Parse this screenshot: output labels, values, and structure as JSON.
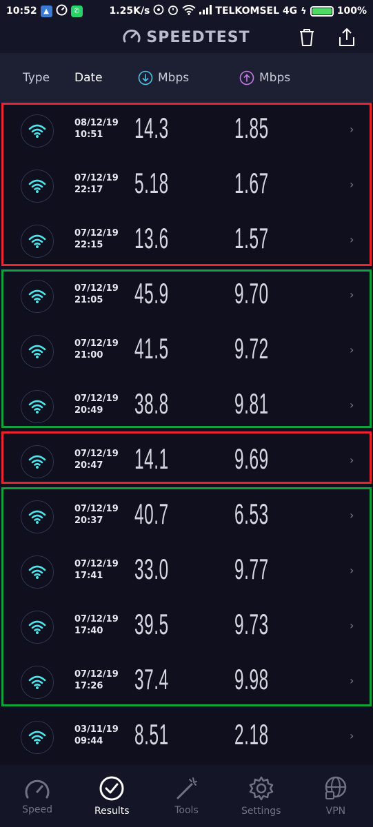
{
  "status": {
    "time": "10:52",
    "speed": "1.25K/s",
    "carrier": "TELKOMSEL 4G",
    "battery": "100%"
  },
  "app": {
    "title": "SPEEDTEST"
  },
  "header": {
    "type": "Type",
    "date": "Date",
    "download_unit": "Mbps",
    "upload_unit": "Mbps"
  },
  "rows": [
    {
      "date": "08/12/19",
      "time": "10:51",
      "download": "14.3",
      "upload": "1.85"
    },
    {
      "date": "07/12/19",
      "time": "22:17",
      "download": "5.18",
      "upload": "1.67"
    },
    {
      "date": "07/12/19",
      "time": "22:15",
      "download": "13.6",
      "upload": "1.57"
    },
    {
      "date": "07/12/19",
      "time": "21:05",
      "download": "45.9",
      "upload": "9.70"
    },
    {
      "date": "07/12/19",
      "time": "21:00",
      "download": "41.5",
      "upload": "9.72"
    },
    {
      "date": "07/12/19",
      "time": "20:49",
      "download": "38.8",
      "upload": "9.81"
    },
    {
      "date": "07/12/19",
      "time": "20:47",
      "download": "14.1",
      "upload": "9.69"
    },
    {
      "date": "07/12/19",
      "time": "20:37",
      "download": "40.7",
      "upload": "6.53"
    },
    {
      "date": "07/12/19",
      "time": "17:41",
      "download": "33.0",
      "upload": "9.77"
    },
    {
      "date": "07/12/19",
      "time": "17:40",
      "download": "39.5",
      "upload": "9.73"
    },
    {
      "date": "07/12/19",
      "time": "17:26",
      "download": "37.4",
      "upload": "9.98"
    },
    {
      "date": "03/11/19",
      "time": "09:44",
      "download": "8.51",
      "upload": "2.18"
    }
  ],
  "colors": {
    "highlight_red": "#e8262f",
    "highlight_green": "#12a23d",
    "wifi_cyan": "#4fe3ea",
    "download_icon": "#4fc3e8",
    "upload_icon": "#c77be6"
  },
  "nav": {
    "speed": "Speed",
    "results": "Results",
    "tools": "Tools",
    "settings": "Settings",
    "vpn": "VPN"
  }
}
